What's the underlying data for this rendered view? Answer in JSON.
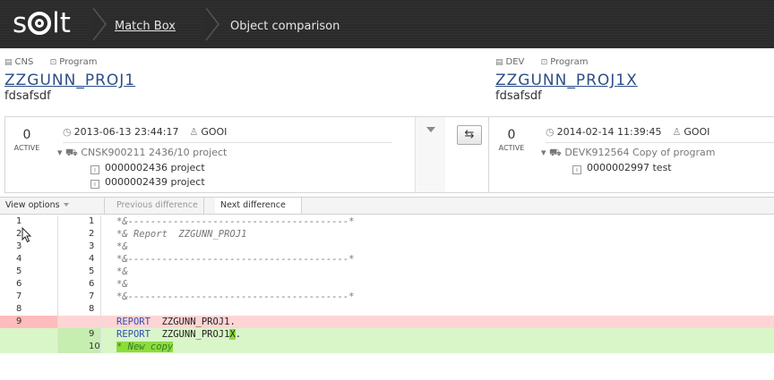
{
  "app": {
    "logo_prefix": "s",
    "logo_suffix": "lt"
  },
  "breadcrumb": {
    "items": [
      "Match Box",
      "Object comparison"
    ]
  },
  "left": {
    "system": "CNS",
    "type": "Program",
    "name": "ZZGUNN_PROJ1",
    "description": "fdsafsdf",
    "version": {
      "number": "0",
      "state": "ACTIVE",
      "datetime": "2013-06-13 23:44:17",
      "user": "GOOI",
      "transport": "CNSK900211 2436/10 project",
      "tasks": [
        "0000002436  project",
        "0000002439  project"
      ]
    }
  },
  "right": {
    "system": "DEV",
    "type": "Program",
    "name": "ZZGUNN_PROJ1X",
    "description": "fdsafsdf",
    "version": {
      "number": "0",
      "state": "ACTIVE",
      "datetime": "2014-02-14 11:39:45",
      "user": "GOOI",
      "transport": "DEVK912564 Copy of program",
      "tasks": [
        "0000002997  test"
      ]
    }
  },
  "toolbar": {
    "view_options": "View options",
    "previous_difference": "Previous difference",
    "next_difference": "Next difference"
  },
  "diff": {
    "rows": [
      {
        "type": "same",
        "l": "1",
        "r": "1",
        "code": "*&---------------------------------------*"
      },
      {
        "type": "same",
        "l": "2",
        "r": "2",
        "code": "*& Report  ZZGUNN_PROJ1"
      },
      {
        "type": "same",
        "l": "3",
        "r": "3",
        "code": "*&"
      },
      {
        "type": "same",
        "l": "4",
        "r": "4",
        "code": "*&---------------------------------------*"
      },
      {
        "type": "same",
        "l": "5",
        "r": "5",
        "code": "*&"
      },
      {
        "type": "same",
        "l": "6",
        "r": "6",
        "code": "*&"
      },
      {
        "type": "same",
        "l": "7",
        "r": "7",
        "code": "*&---------------------------------------*"
      },
      {
        "type": "same",
        "l": "8",
        "r": "8",
        "code": ""
      },
      {
        "type": "del",
        "l": "9",
        "r": "",
        "keyword": "REPORT",
        "rest": "  ZZGUNN_PROJ1."
      },
      {
        "type": "ins",
        "l": "",
        "r": "9",
        "keyword": "REPORT",
        "rest_a": "  ZZGUNN_PROJ1",
        "rest_hl": "X",
        "rest_b": "."
      },
      {
        "type": "ins",
        "l": "",
        "r": "10",
        "code": "* New copy"
      }
    ]
  }
}
